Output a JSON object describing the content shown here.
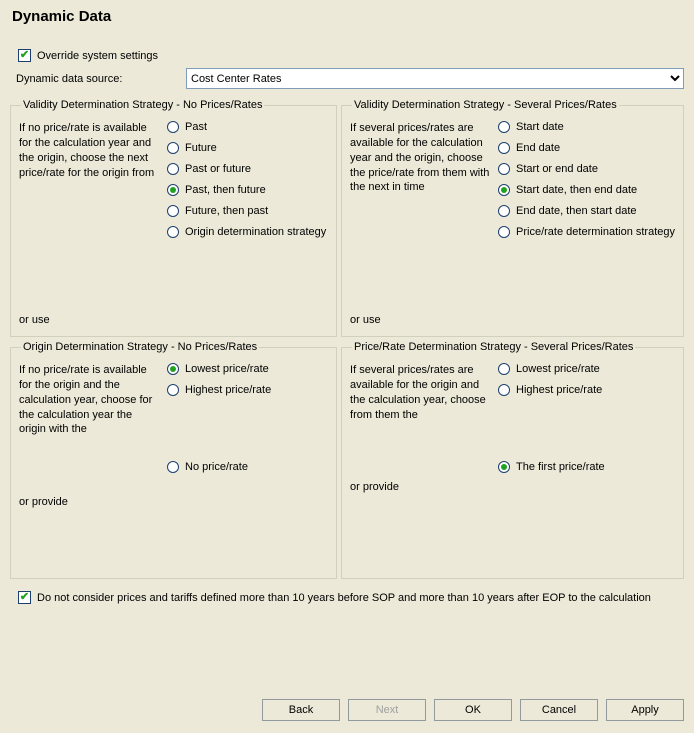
{
  "title": "Dynamic Data",
  "override": {
    "label": "Override system settings",
    "checked": true
  },
  "source": {
    "label": "Dynamic data source:",
    "value": "Cost Center Rates",
    "options": [
      "Cost Center Rates"
    ]
  },
  "group_vds_no": {
    "legend": "Validity Determination Strategy - No Prices/Rates",
    "desc": "If no price/rate  is available for the calculation year and the origin, choose the next price/rate for the origin from",
    "or_label": "or use",
    "opts": [
      {
        "label": "Past",
        "checked": false
      },
      {
        "label": "Future",
        "checked": false
      },
      {
        "label": "Past or future",
        "checked": false
      },
      {
        "label": "Past, then future",
        "checked": true
      },
      {
        "label": "Future, then past",
        "checked": false
      },
      {
        "label": "Origin determination strategy",
        "checked": false
      }
    ]
  },
  "group_vds_sev": {
    "legend": "Validity Determination Strategy - Several Prices/Rates",
    "desc": "If several prices/rates are available for the calculation year and the origin, choose the price/rate from them with the next in time",
    "or_label": "or use",
    "opts": [
      {
        "label": "Start date",
        "checked": false
      },
      {
        "label": "End date",
        "checked": false
      },
      {
        "label": "Start or end date",
        "checked": false
      },
      {
        "label": "Start date, then end date",
        "checked": true
      },
      {
        "label": "End date, then start date",
        "checked": false
      },
      {
        "label": "Price/rate determination strategy",
        "checked": false
      }
    ]
  },
  "group_ods_no": {
    "legend": "Origin Determination Strategy - No Prices/Rates",
    "desc": "If no price/rate is available for the origin and the calculation year, choose for the calculation year the origin with the",
    "or_label": "or provide",
    "opts_top": [
      {
        "label": "Lowest price/rate",
        "checked": true
      },
      {
        "label": "Highest price/rate",
        "checked": false
      }
    ],
    "opts_bottom": [
      {
        "label": "No price/rate",
        "checked": false
      }
    ]
  },
  "group_prds_sev": {
    "legend": "Price/Rate Determination Strategy - Several Prices/Rates",
    "desc": "If several prices/rates are available for the origin and the calculation year, choose from them the",
    "or_label": "or provide",
    "opts_top": [
      {
        "label": "Lowest price/rate",
        "checked": false
      },
      {
        "label": "Highest price/rate",
        "checked": false
      }
    ],
    "opts_bottom": [
      {
        "label": "The first price/rate",
        "checked": true
      }
    ]
  },
  "footnote": {
    "label": "Do not consider prices and tariffs defined more than 10 years before SOP and more than 10 years after EOP to the calculation",
    "checked": true
  },
  "buttons": {
    "back": "Back",
    "next": "Next",
    "ok": "OK",
    "cancel": "Cancel",
    "apply": "Apply"
  }
}
